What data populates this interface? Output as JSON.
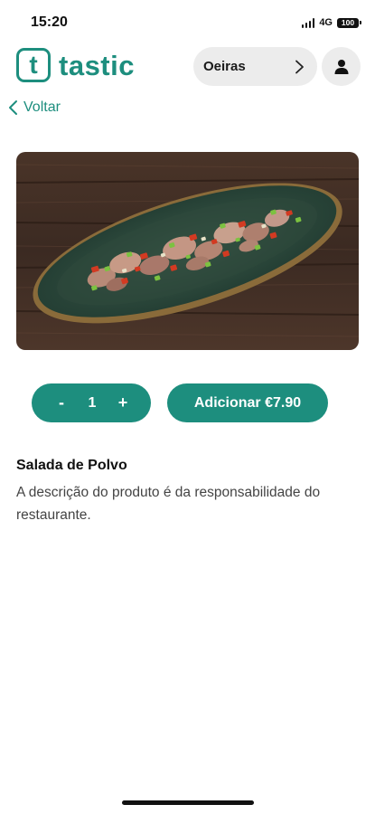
{
  "status_bar": {
    "time": "15:20",
    "network": "4G",
    "battery": "100"
  },
  "header": {
    "logo_letter": "t",
    "logo_text": "tastic",
    "location": "Oeiras",
    "icons": {
      "location_chevron": "chevron-right-icon",
      "profile": "user-icon"
    }
  },
  "nav": {
    "back_label": "Voltar",
    "back_icon": "chevron-left-icon"
  },
  "product": {
    "image_icon": "octopus-salad-photo",
    "quantity": "1",
    "decrement_label": "-",
    "increment_label": "+",
    "add_button_label": "Adicionar €7.90",
    "name": "Salada de Polvo",
    "description": "A descrição do produto é da responsabilidade do restaurante."
  },
  "colors": {
    "brand": "#1d8e7e",
    "pill_bg": "#ececec"
  }
}
